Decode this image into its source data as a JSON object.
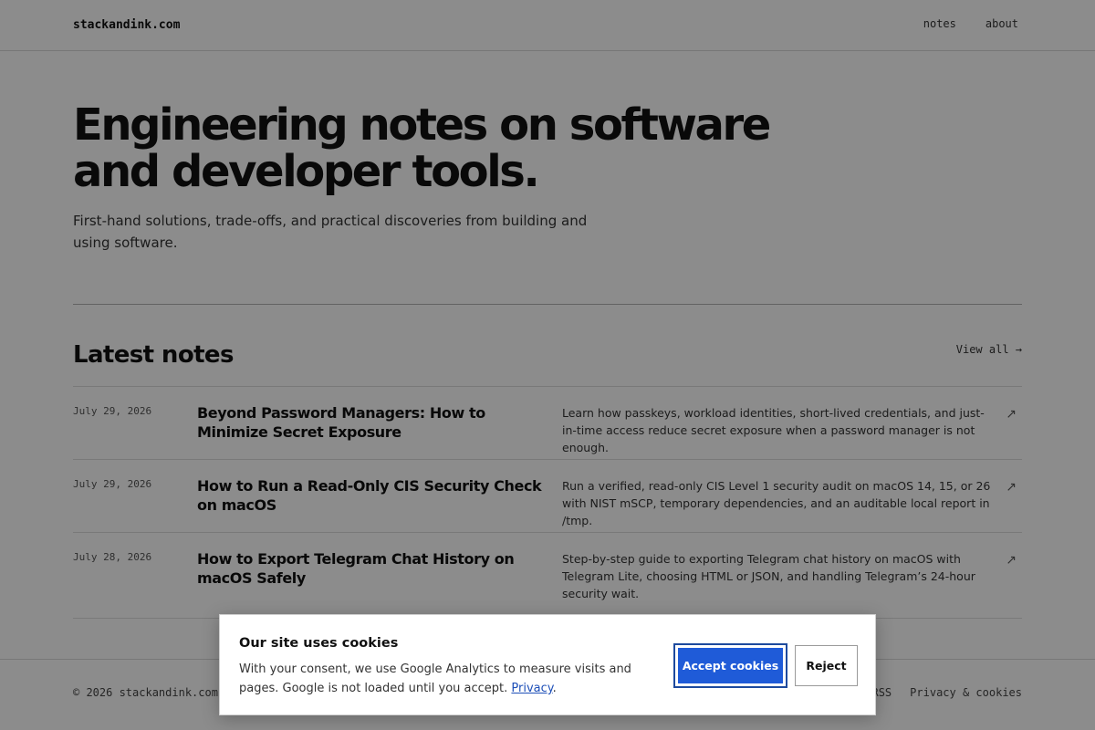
{
  "header": {
    "brand": "stackandink.com",
    "nav": [
      {
        "label": "notes"
      },
      {
        "label": "about"
      }
    ]
  },
  "hero": {
    "title": "Engineering notes on software and developer tools.",
    "subtitle": "First-hand solutions, trade-offs, and practical discoveries from building and using software."
  },
  "latest": {
    "title": "Latest notes",
    "view_all": "View all →",
    "notes": [
      {
        "date": "July 29, 2026",
        "title": "Beyond Password Managers: How to Minimize Secret Exposure",
        "description": "Learn how passkeys, workload identities, short-lived credentials, and just-in-time access reduce secret exposure when a password manager is not enough.",
        "arrow": "↗"
      },
      {
        "date": "July 29, 2026",
        "title": "How to Run a Read-Only CIS Security Check on macOS",
        "description": "Run a verified, read-only CIS Level 1 security audit on macOS 14, 15, or 26 with NIST mSCP, temporary dependencies, and an auditable local report in /tmp.",
        "arrow": "↗"
      },
      {
        "date": "July 28, 2026",
        "title": "How to Export Telegram Chat History on macOS Safely",
        "description": "Step-by-step guide to exporting Telegram chat history on macOS with Telegram Lite, choosing HTML or JSON, and handling Telegram’s 24-hour security wait.",
        "arrow": "↗"
      }
    ]
  },
  "footer": {
    "copyright": "© 2026 stackandink.com",
    "links": [
      {
        "label": "RSS"
      },
      {
        "label": "Privacy & cookies"
      }
    ]
  },
  "cookie_banner": {
    "title": "Our site uses cookies",
    "text_before_link": "With your consent, we use Google Analytics to measure visits and pages. Google is not loaded until you accept. ",
    "link_label": "Privacy",
    "text_after_link": ".",
    "accept_label": "Accept cookies",
    "reject_label": "Reject"
  },
  "colors": {
    "accent": "#1f5bd8",
    "link": "#1d4fb8",
    "overlay": "rgba(0,0,0,0.45)"
  }
}
